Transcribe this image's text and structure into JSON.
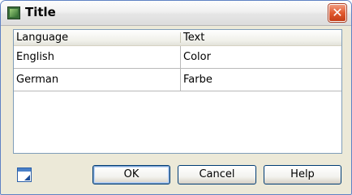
{
  "window": {
    "title": "Title",
    "icons": {
      "app": "app-icon",
      "close": "close-icon",
      "close_glyph": "✕",
      "edit": "edit-icon"
    }
  },
  "table": {
    "columns": [
      "Language",
      "Text"
    ],
    "rows": [
      [
        "English",
        "Color"
      ],
      [
        "German",
        "Farbe"
      ]
    ]
  },
  "buttons": {
    "ok": "OK",
    "cancel": "Cancel",
    "help": "Help"
  },
  "colors": {
    "close_red": "#e15a30",
    "frame_blue": "#5f82c4",
    "dialog_bg": "#ece9d8"
  }
}
